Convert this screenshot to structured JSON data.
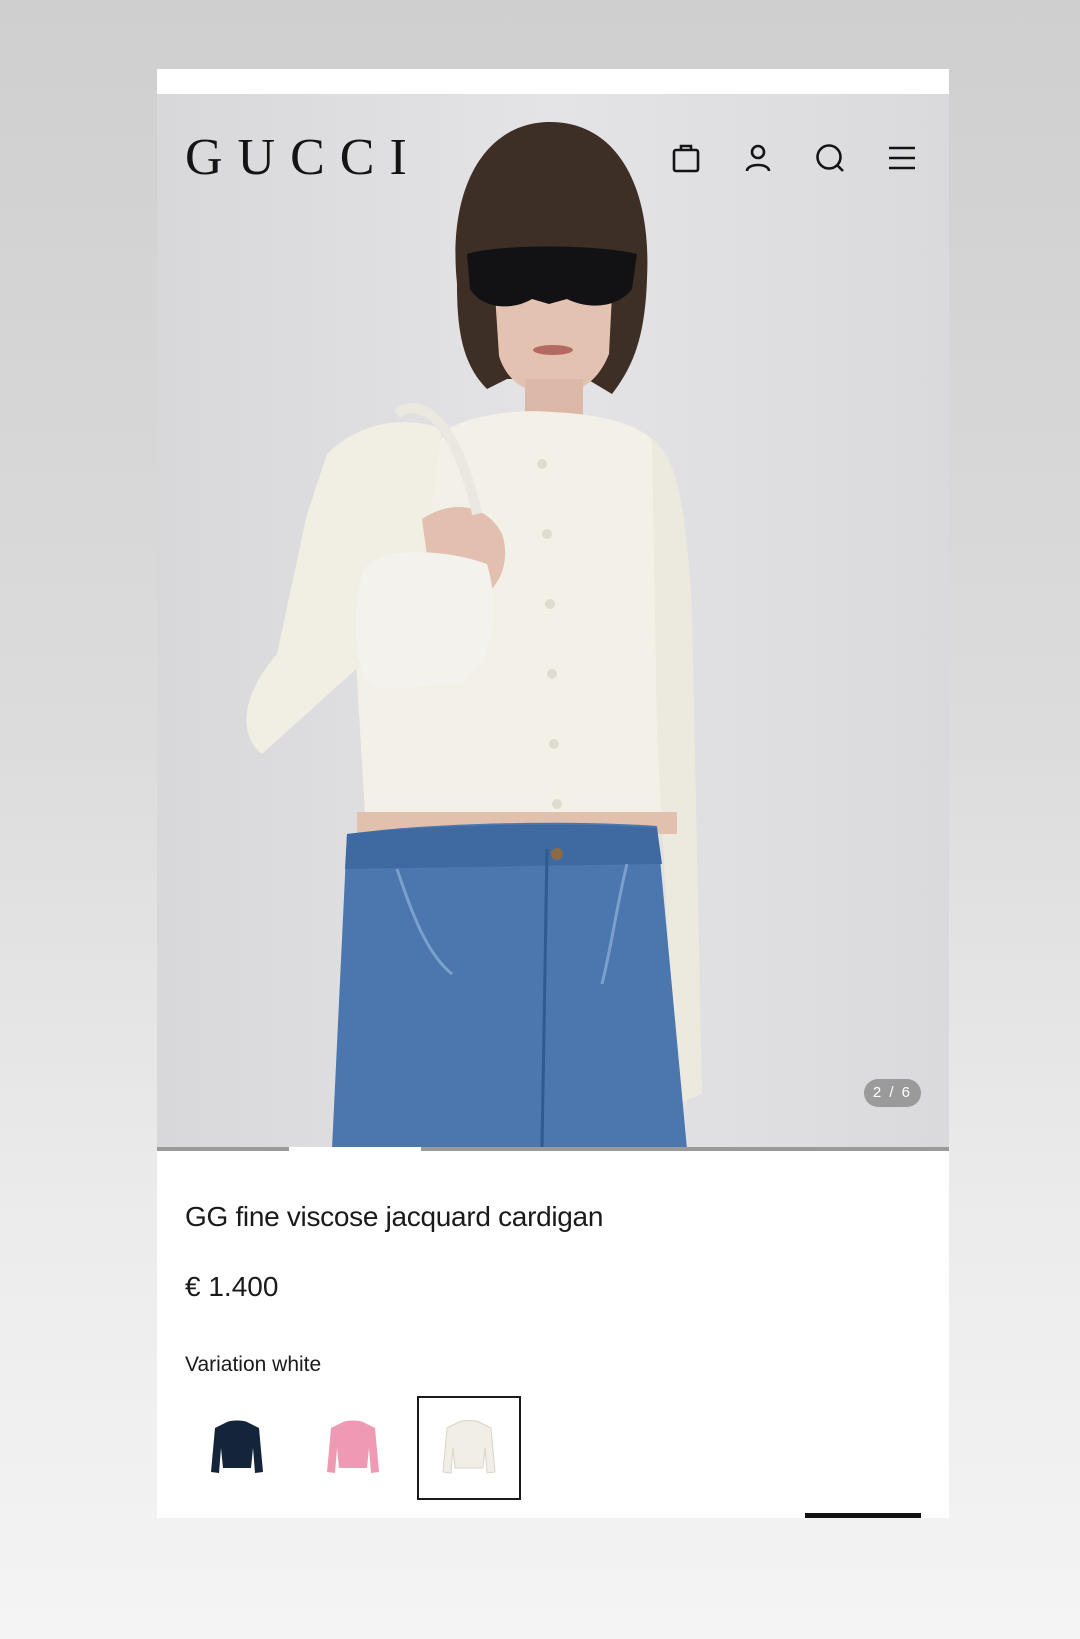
{
  "brand": {
    "logo_text": "GUCCI"
  },
  "header_icons": [
    {
      "name": "shopping-bag-icon"
    },
    {
      "name": "account-icon"
    },
    {
      "name": "search-icon"
    },
    {
      "name": "menu-icon"
    }
  ],
  "gallery": {
    "counter_text": "2 / 6",
    "current": 2,
    "total": 6
  },
  "product": {
    "title": "GG fine viscose jacquard cardigan",
    "price": "€ 1.400",
    "variation_label": "Variation",
    "variation_value": "white"
  },
  "variations": [
    {
      "name": "navy",
      "color": "#14243a",
      "selected": false
    },
    {
      "name": "pink",
      "color": "#ef9ab5",
      "selected": false
    },
    {
      "name": "white",
      "color": "#f1eee5",
      "selected": true
    }
  ],
  "colors": {
    "text": "#1a1a1a",
    "hero_background": "#e2e2e4"
  }
}
